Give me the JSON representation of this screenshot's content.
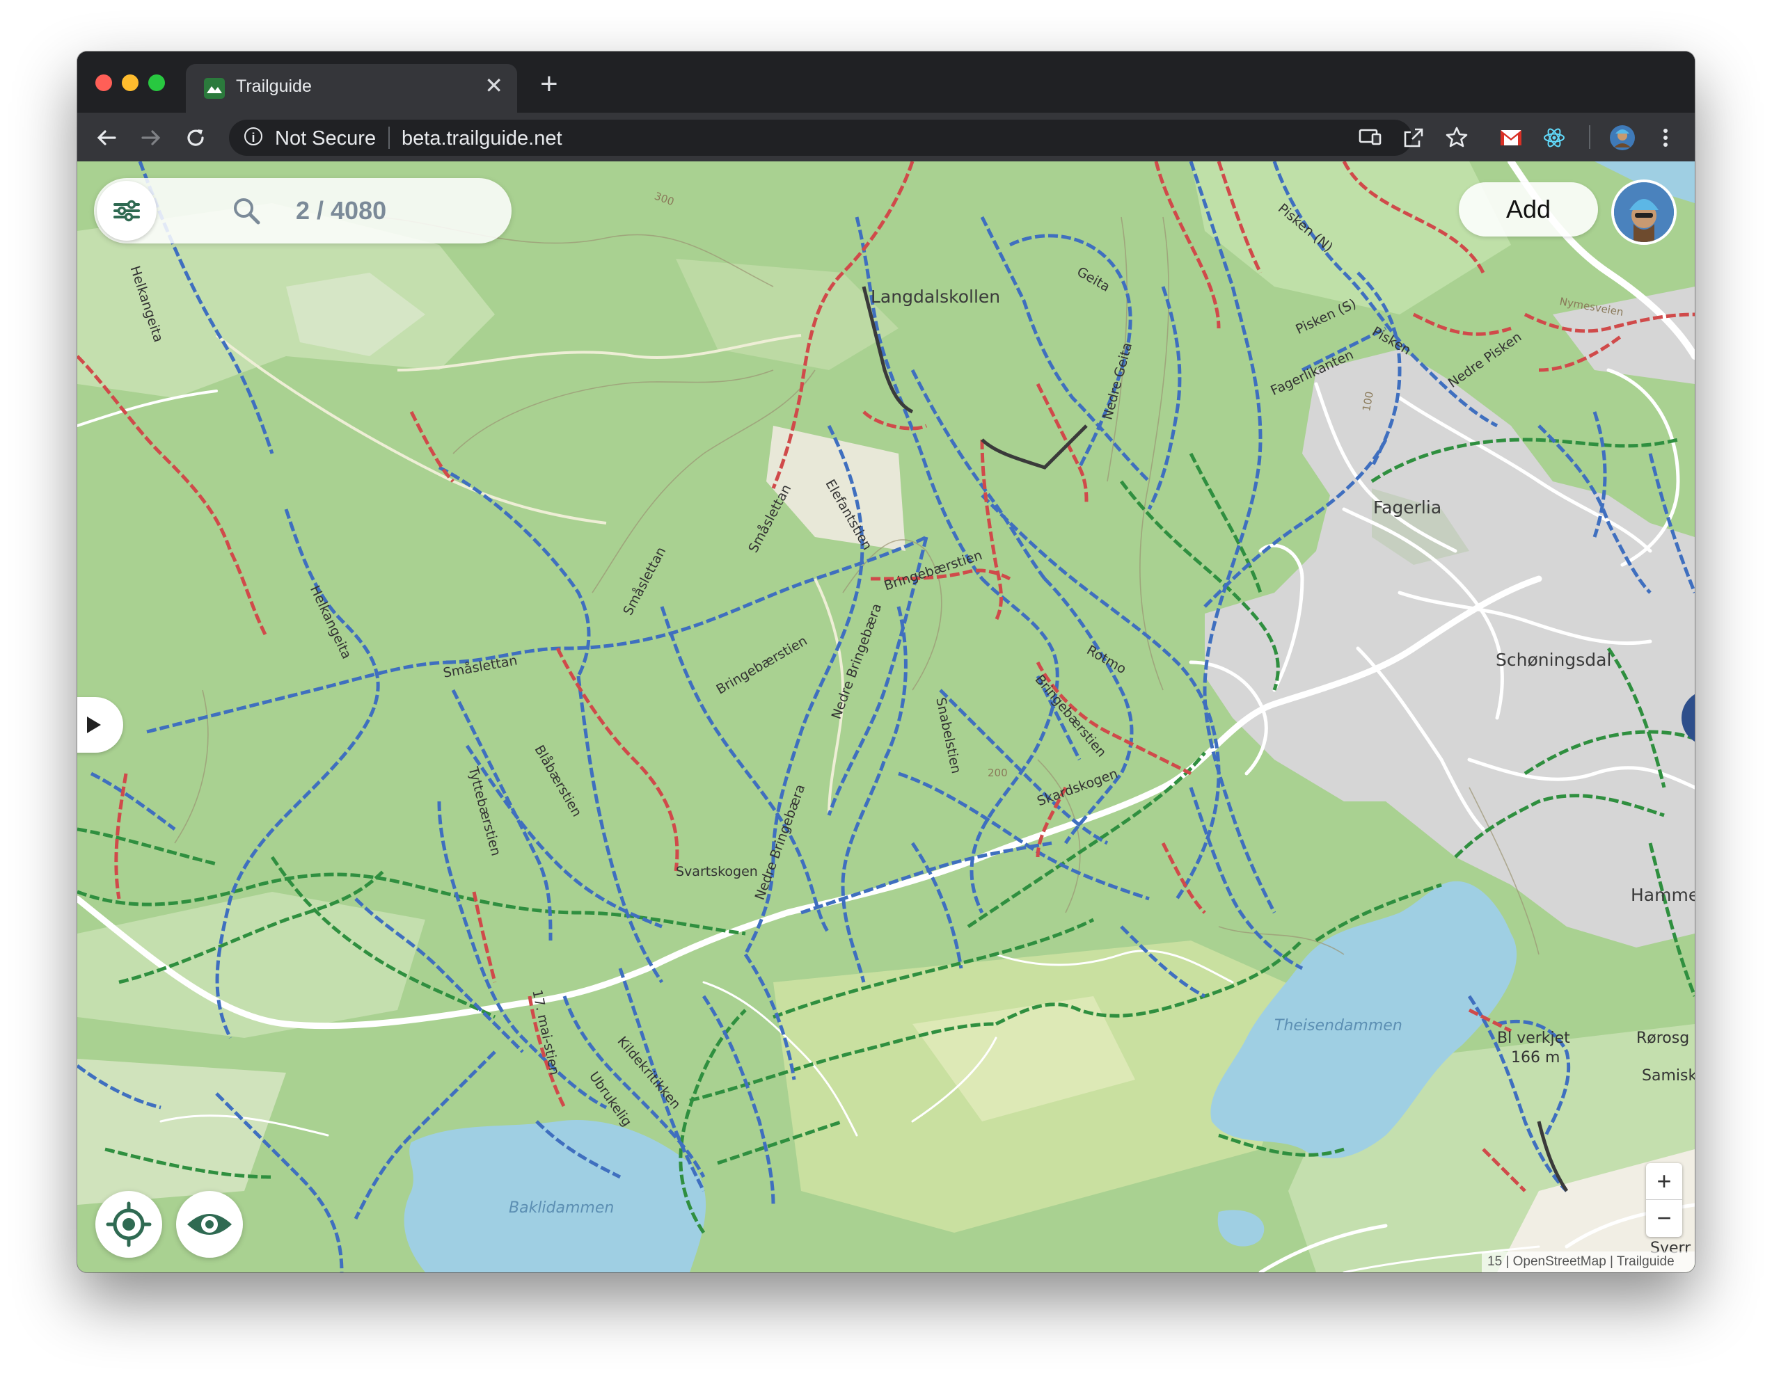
{
  "browser": {
    "tab_title": "Trailguide",
    "tab_close": "✕",
    "new_tab": "+",
    "security_label": "Not Secure",
    "url": "beta.trailguide.net",
    "info_glyph": "i"
  },
  "app": {
    "search_count": "2 / 4080",
    "add_label": "Add",
    "zoom_in": "+",
    "zoom_out": "−",
    "attribution": "15 | OpenStreetMap | Trailguide",
    "colors": {
      "brand_green": "#2b7a3c",
      "trail_blue": "#3f6fbf",
      "trail_red": "#d04a4a",
      "trail_green": "#2f8f3f",
      "trail_black": "#333333",
      "layers_button": "#2e4f8b"
    }
  },
  "map": {
    "places": {
      "fagerlia": "Fagerlia",
      "schoningsdal": "Schøningsdal",
      "hamme": "Hamme",
      "rorosg": "Rørosg",
      "samisk": "Samisk",
      "sverr": "Sverr",
      "langdalskollen": "Langdalskollen",
      "bjerkjet": "Bl  verkjet",
      "bjerkjet_elev": "166 m"
    },
    "water": {
      "theisendammen": "Theisendammen",
      "baklidammen": "Baklidammen"
    },
    "roads": {
      "nymesveien": "Nymesveien"
    },
    "contours": {
      "c300": "300",
      "c100": "100",
      "c200": "200"
    },
    "trails": {
      "helkangeita_1": "Helkangeita",
      "helkangeita_2": "Helkangeita",
      "smaslettan_1": "Småslettan",
      "smaslettan_2": "Småslettan",
      "smaslettan_3": "Småslettan",
      "elefantstien": "Elefantstien",
      "geita": "Geita",
      "nedre_geita": "Nedre Geita",
      "pisken_n": "Pisken (N)",
      "pisken_s": "Pisken (S)",
      "pisken": "Pisken",
      "nedre_pisken": "Nedre Pisken",
      "fagerlikanten": "Fagerlikanten",
      "bringebaerstien_1": "Bringebærstien",
      "bringebaerstien_2": "Bringebærstien",
      "bringebaerstien_3": "Bringebærstien",
      "nedre_bringebaera_1": "Nedre Bringebæra",
      "nedre_bringebaera_2": "Nedre Bringebæra",
      "rotmo": "Rotmo",
      "snabelstien": "Snabelstien",
      "skardskogen": "Skardskogen",
      "tyttebaerstien": "Tyttebærstien",
      "blabaerstien": "Blåbærstien",
      "svartskogen": "Svartskogen",
      "mai_stien": "17. mai-stien",
      "kildekritikken": "Kildekritikken",
      "ubrukelig": "Ubrukelig"
    }
  }
}
